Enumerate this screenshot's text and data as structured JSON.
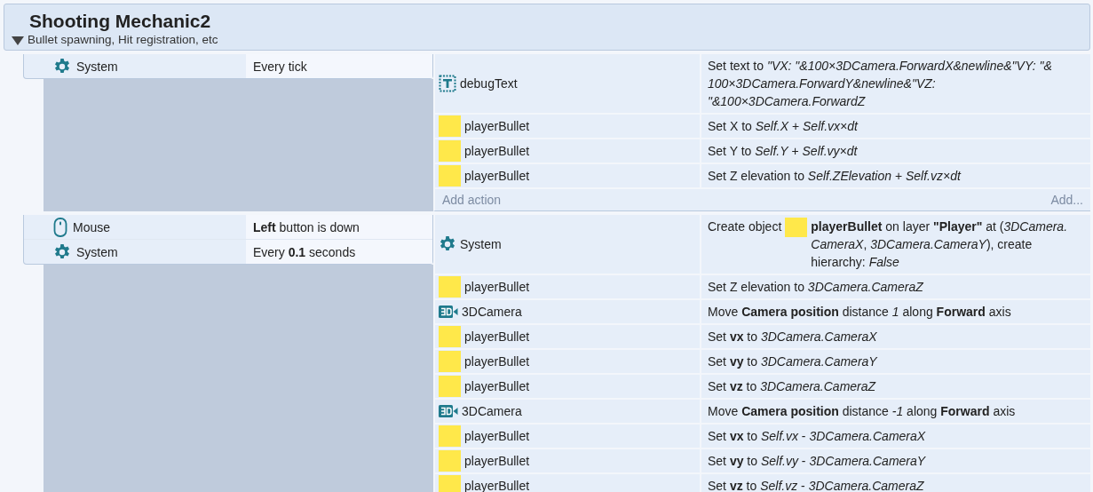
{
  "group": {
    "title": "Shooting Mechanic2",
    "description": "Bullet spawning, Hit registration, etc",
    "expanded": true
  },
  "events": [
    {
      "conditions": [
        {
          "object": "System",
          "kind": "system",
          "text": "Every tick"
        }
      ],
      "actions": [
        {
          "object": "debugText",
          "kind": "text",
          "text": "Set text to *\"VX: \"&100×3DCamera.ForwardX&newline&\"VY: \"& 100×3DCamera.ForwardY&newline&\"VZ: \"&100×3DCamera.ForwardZ*"
        },
        {
          "object": "playerBullet",
          "kind": "sprite",
          "text": "Set X to *Self.X* + *Self.vx×dt*"
        },
        {
          "object": "playerBullet",
          "kind": "sprite",
          "text": "Set Y to *Self.Y* + *Self.vy×dt*"
        },
        {
          "object": "playerBullet",
          "kind": "sprite",
          "text": "Set Z elevation to *Self.ZElevation* + *Self.vz×dt*"
        }
      ],
      "add_action": {
        "label": "Add action",
        "more": "Add..."
      }
    },
    {
      "conditions": [
        {
          "object": "Mouse",
          "kind": "mouse",
          "text": "**Left** button is down"
        },
        {
          "object": "System",
          "kind": "system",
          "text": "Every **0.1** seconds"
        }
      ],
      "actions": [
        {
          "object": "System",
          "kind": "system",
          "segments": [
            {
              "kind": "text",
              "text": "Create object"
            },
            {
              "kind": "sprite-icon"
            },
            {
              "kind": "text",
              "text": "**playerBullet** on layer **\"Player\"** at (*3DCamera. CameraX*, *3DCamera.CameraY*), create hierarchy: *False*"
            }
          ]
        },
        {
          "object": "playerBullet",
          "kind": "sprite",
          "text": "Set Z elevation to *3DCamera.CameraZ*"
        },
        {
          "object": "3DCamera",
          "kind": "camera",
          "text": "Move **Camera position** distance *1* along **Forward** axis"
        },
        {
          "object": "playerBullet",
          "kind": "sprite",
          "text": "Set **vx** to *3DCamera.CameraX*"
        },
        {
          "object": "playerBullet",
          "kind": "sprite",
          "text": "Set **vy** to *3DCamera.CameraY*"
        },
        {
          "object": "playerBullet",
          "kind": "sprite",
          "text": "Set **vz** to *3DCamera.CameraZ*"
        },
        {
          "object": "3DCamera",
          "kind": "camera",
          "text": "Move **Camera position** distance *-1* along **Forward** axis"
        },
        {
          "object": "playerBullet",
          "kind": "sprite",
          "text": "Set **vx** to *Self.vx* - *3DCamera.CameraX*"
        },
        {
          "object": "playerBullet",
          "kind": "sprite",
          "text": "Set **vy** to *Self.vy* - *3DCamera.CameraY*"
        },
        {
          "object": "playerBullet",
          "kind": "sprite",
          "text": "Set **vz** to *Self.vz* - *3DCamera.CameraZ*"
        }
      ]
    }
  ]
}
